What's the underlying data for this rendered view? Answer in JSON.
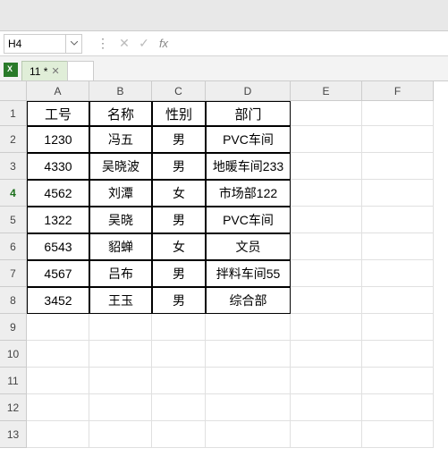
{
  "formula_bar": {
    "cell_ref": "H4",
    "fx_label": "fx"
  },
  "file_tab": {
    "label": "11 *"
  },
  "columns": [
    "A",
    "B",
    "C",
    "D",
    "E",
    "F"
  ],
  "rows_shown": 13,
  "active_row": 4,
  "headers": {
    "A": "工号",
    "B": "名称",
    "C": "性别",
    "D": "部门"
  },
  "data": [
    {
      "A": "1230",
      "B": "冯五",
      "C": "男",
      "D": "PVC车间"
    },
    {
      "A": "4330",
      "B": "吴晓波",
      "C": "男",
      "D": "地暖车间233"
    },
    {
      "A": "4562",
      "B": "刘潭",
      "C": "女",
      "D": "市场部122"
    },
    {
      "A": "1322",
      "B": "吴晓",
      "C": "男",
      "D": "PVC车间"
    },
    {
      "A": "6543",
      "B": "貂蝉",
      "C": "女",
      "D": "文员"
    },
    {
      "A": "4567",
      "B": "吕布",
      "C": "男",
      "D": "拌料车间55"
    },
    {
      "A": "3452",
      "B": "王玉",
      "C": "男",
      "D": "综合部"
    }
  ],
  "chart_data": {
    "type": "table",
    "columns": [
      "工号",
      "名称",
      "性别",
      "部门"
    ],
    "rows": [
      [
        "1230",
        "冯五",
        "男",
        "PVC车间"
      ],
      [
        "4330",
        "吴晓波",
        "男",
        "地暖车间233"
      ],
      [
        "4562",
        "刘潭",
        "女",
        "市场部122"
      ],
      [
        "1322",
        "吴晓",
        "男",
        "PVC车间"
      ],
      [
        "6543",
        "貂蝉",
        "女",
        "文员"
      ],
      [
        "4567",
        "吕布",
        "男",
        "拌料车间55"
      ],
      [
        "3452",
        "王玉",
        "男",
        "综合部"
      ]
    ]
  }
}
